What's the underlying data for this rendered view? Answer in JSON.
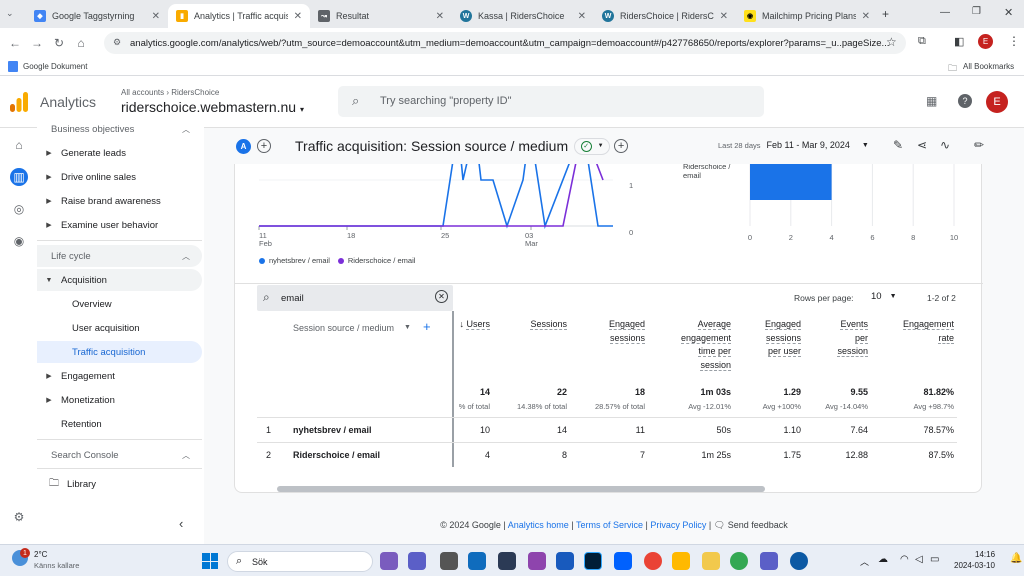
{
  "browser": {
    "tabs": [
      {
        "label": "Google Taggstyrning"
      },
      {
        "label": "Analytics | Traffic acquisitio"
      },
      {
        "label": "Resultat"
      },
      {
        "label": "Kassa | RidersChoice"
      },
      {
        "label": "RidersChoice | RidersCho"
      },
      {
        "label": "Mailchimp Pricing Plans | "
      }
    ],
    "url": "analytics.google.com/analytics/web/?utm_source=demoaccount&utm_medium=demoaccount&utm_campaign=demoaccount#/p427768650/reports/explorer?params=_u..pageSize...",
    "bookmark_left": "Google Dokument",
    "bookmark_right": "All Bookmarks",
    "profile_initial": "E"
  },
  "ga": {
    "product": "Analytics",
    "breadcrumb_all": "All accounts",
    "breadcrumb_acct": "RidersChoice",
    "property": "riderschoice.webmastern.nu",
    "search_placeholder": "Try searching \"property ID\"",
    "avatar": "E"
  },
  "sidebar": {
    "business_objectives": "Business objectives",
    "items_bo": [
      "Generate leads",
      "Drive online sales",
      "Raise brand awareness",
      "Examine user behavior"
    ],
    "life_cycle": "Life cycle",
    "acquisition": "Acquisition",
    "acq_items": [
      "Overview",
      "User acquisition",
      "Traffic acquisition"
    ],
    "engagement": "Engagement",
    "monetization": "Monetization",
    "retention": "Retention",
    "search_console": "Search Console",
    "library": "Library"
  },
  "toolbar": {
    "segment_badge": "A",
    "title": "Traffic acquisition: Session source / medium",
    "date_label": "Last 28 days",
    "date_range": "Feb 11 - Mar 9, 2024"
  },
  "line_chart": {
    "x_ticks": [
      {
        "d": "11",
        "m": "Feb"
      },
      {
        "d": "18",
        "m": ""
      },
      {
        "d": "25",
        "m": ""
      },
      {
        "d": "03",
        "m": "Mar"
      }
    ],
    "y_ticks": [
      "1",
      "0"
    ],
    "legend": [
      "nyhetsbrev / email",
      "Riderschoice / email"
    ],
    "colors": [
      "#1a73e8",
      "#7b2fd8"
    ]
  },
  "bar_chart": {
    "label": "Riderschoice / email",
    "x_ticks": [
      "0",
      "2",
      "4",
      "6",
      "8",
      "10"
    ],
    "value": 4,
    "color": "#1a73e8"
  },
  "table": {
    "search_value": "email",
    "rows_per_page_label": "Rows per page:",
    "rows_per_page": "10",
    "pagination": "1-2 of 2",
    "dimension_header": "Session source / medium",
    "headers": [
      [
        "Users"
      ],
      [
        "Sessions"
      ],
      [
        "Engaged",
        "sessions"
      ],
      [
        "Average",
        "engagement",
        "time per",
        "session"
      ],
      [
        "Engaged",
        "sessions",
        "per user"
      ],
      [
        "Events",
        "per",
        "session"
      ],
      [
        "Engagement",
        "rate"
      ]
    ],
    "totals": [
      "14",
      "22",
      "18",
      "1m 03s",
      "1.29",
      "9.55",
      "81.82%"
    ],
    "totals_sub": [
      "% of total",
      "14.38% of total",
      "28.57% of total",
      "Avg -12.01%",
      "Avg +100%",
      "Avg -14.04%",
      "Avg +98.7%"
    ],
    "rows": [
      {
        "n": "1",
        "dim": "nyhetsbrev / email",
        "vals": [
          "10",
          "14",
          "11",
          "50s",
          "1.10",
          "7.64",
          "78.57%"
        ]
      },
      {
        "n": "2",
        "dim": "Riderschoice / email",
        "vals": [
          "4",
          "8",
          "7",
          "1m 25s",
          "1.75",
          "12.88",
          "87.5%"
        ]
      }
    ]
  },
  "footer": {
    "copyright": "© 2024 Google |",
    "links": [
      "Analytics home",
      "Terms of Service",
      "Privacy Policy"
    ],
    "feedback": "Send feedback"
  },
  "taskbar": {
    "temp": "2°C",
    "weather": "Känns kallare",
    "search": "Sök",
    "time": "14:16",
    "date": "2024-03-10",
    "badge": "1"
  }
}
